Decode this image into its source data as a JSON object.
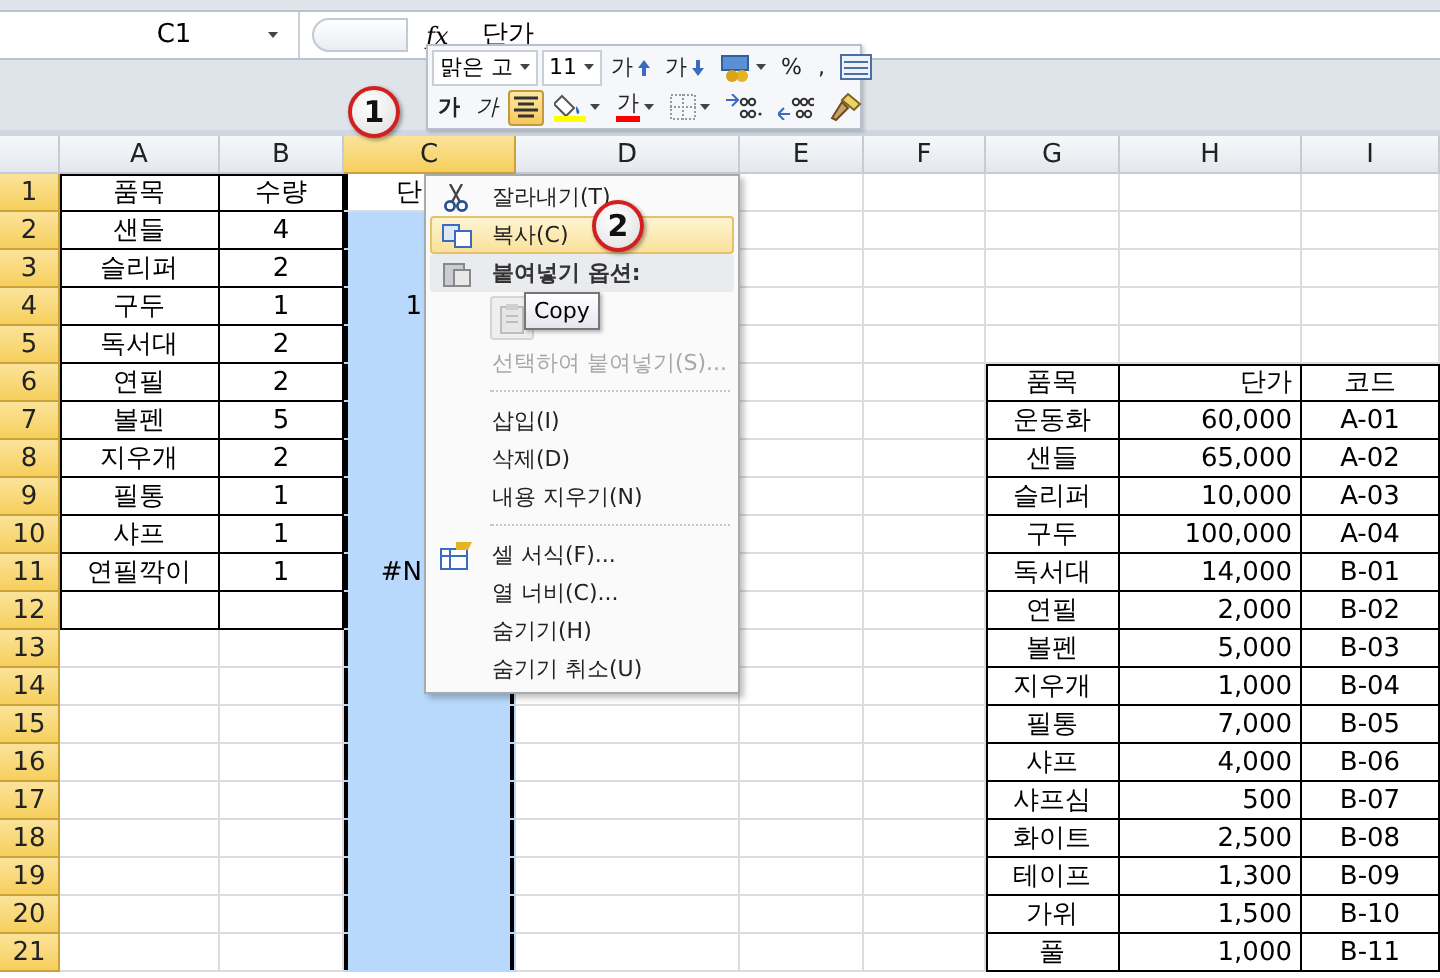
{
  "name_box": {
    "value": "C1"
  },
  "formula_bar": {
    "function_label": "fx",
    "value": "단가"
  },
  "mini_toolbar": {
    "font": "맑은 고",
    "size": "11",
    "row1": [
      {
        "kind": "grow",
        "label": "가"
      },
      {
        "kind": "shrink",
        "label": "가"
      },
      {
        "kind": "accounting"
      },
      {
        "kind": "percent",
        "label": "%"
      },
      {
        "kind": "comma",
        "label": ","
      },
      {
        "kind": "number-format"
      }
    ],
    "row2": [
      {
        "kind": "bold",
        "label": "가",
        "selected": false
      },
      {
        "kind": "italic",
        "label": "가",
        "selected": false
      },
      {
        "kind": "center",
        "selected": true
      },
      {
        "kind": "fill"
      },
      {
        "kind": "font-color",
        "label": "가"
      },
      {
        "kind": "borders"
      },
      {
        "kind": "increase-decimal"
      },
      {
        "kind": "decrease-decimal"
      },
      {
        "kind": "format-painter"
      }
    ]
  },
  "columns": [
    {
      "label": "A",
      "selected": false
    },
    {
      "label": "B",
      "selected": false
    },
    {
      "label": "C",
      "selected": true
    },
    {
      "label": "D",
      "selected": false
    },
    {
      "label": "E",
      "selected": false
    },
    {
      "label": "F",
      "selected": false
    },
    {
      "label": "G",
      "selected": false
    },
    {
      "label": "H",
      "selected": false
    },
    {
      "label": "I",
      "selected": false
    }
  ],
  "rows": [
    {
      "header": "1",
      "selected": true,
      "cells": {
        "a": "품목",
        "b": "수량",
        "c": "단"
      }
    },
    {
      "header": "2",
      "selected": true,
      "cells": {
        "a": "샌들",
        "b": "4"
      }
    },
    {
      "header": "3",
      "selected": true,
      "cells": {
        "a": "슬리퍼",
        "b": "2"
      }
    },
    {
      "header": "4",
      "selected": true,
      "cells": {
        "a": "구두",
        "b": "1",
        "c": "1"
      }
    },
    {
      "header": "5",
      "selected": true,
      "cells": {
        "a": "독서대",
        "b": "2"
      }
    },
    {
      "header": "6",
      "selected": true,
      "cells": {
        "a": "연필",
        "b": "2",
        "g": "품목",
        "h": "단가",
        "i": "코드"
      }
    },
    {
      "header": "7",
      "selected": true,
      "cells": {
        "a": "볼펜",
        "b": "5",
        "g": "운동화",
        "h": "60,000",
        "i": "A-01"
      }
    },
    {
      "header": "8",
      "selected": true,
      "cells": {
        "a": "지우개",
        "b": "2",
        "g": "샌들",
        "h": "65,000",
        "i": "A-02"
      }
    },
    {
      "header": "9",
      "selected": true,
      "cells": {
        "a": "필통",
        "b": "1",
        "g": "슬리퍼",
        "h": "10,000",
        "i": "A-03"
      }
    },
    {
      "header": "10",
      "selected": true,
      "cells": {
        "a": "샤프",
        "b": "1",
        "g": "구두",
        "h": "100,000",
        "i": "A-04"
      }
    },
    {
      "header": "11",
      "selected": true,
      "cells": {
        "a": "연필깍이",
        "b": "1",
        "c": "#N",
        "g": "독서대",
        "h": "14,000",
        "i": "B-01"
      }
    },
    {
      "header": "12",
      "selected": true,
      "cells": {
        "g": "연필",
        "h": "2,000",
        "i": "B-02"
      }
    },
    {
      "header": "13",
      "selected": true,
      "cells": {
        "g": "볼펜",
        "h": "5,000",
        "i": "B-03"
      }
    },
    {
      "header": "14",
      "selected": true,
      "cells": {
        "g": "지우개",
        "h": "1,000",
        "i": "B-04"
      }
    },
    {
      "header": "15",
      "selected": true,
      "cells": {
        "g": "필통",
        "h": "7,000",
        "i": "B-05"
      }
    },
    {
      "header": "16",
      "selected": true,
      "cells": {
        "g": "샤프",
        "h": "4,000",
        "i": "B-06"
      }
    },
    {
      "header": "17",
      "selected": true,
      "cells": {
        "g": "샤프심",
        "h": "500",
        "i": "B-07"
      }
    },
    {
      "header": "18",
      "selected": true,
      "cells": {
        "g": "화이트",
        "h": "2,500",
        "i": "B-08"
      }
    },
    {
      "header": "19",
      "selected": true,
      "cells": {
        "g": "테이프",
        "h": "1,300",
        "i": "B-09"
      }
    },
    {
      "header": "20",
      "selected": true,
      "cells": {
        "g": "가위",
        "h": "1,500",
        "i": "B-10"
      }
    },
    {
      "header": "21",
      "selected": true,
      "cells": {
        "g": "풀",
        "h": "1,000",
        "i": "B-11"
      }
    }
  ],
  "context_menu": [
    {
      "kind": "scissors",
      "label": "잘라내기(T)",
      "selected": false,
      "disabled": false
    },
    {
      "kind": "copy",
      "label": "복사(C)",
      "selected": true,
      "disabled": false
    },
    {
      "kind": "heading",
      "label": "붙여넣기 옵션:"
    },
    {
      "kind": "paste",
      "disabled": true
    },
    {
      "kind": "plain",
      "label": "선택하여 붙여넣기(S)...",
      "selected": false,
      "disabled": true
    },
    {
      "kind": "separator"
    },
    {
      "kind": "plain",
      "label": "삽입(I)",
      "selected": false,
      "disabled": false
    },
    {
      "kind": "plain",
      "label": "삭제(D)",
      "selected": false,
      "disabled": false
    },
    {
      "kind": "plain",
      "label": "내용 지우기(N)",
      "selected": false,
      "disabled": false
    },
    {
      "kind": "separator"
    },
    {
      "kind": "format",
      "label": "셀 서식(F)...",
      "selected": false,
      "disabled": false
    },
    {
      "kind": "plain",
      "label": "열 너비(C)...",
      "selected": false,
      "disabled": false
    },
    {
      "kind": "plain",
      "label": "숨기기(H)",
      "selected": false,
      "disabled": false
    },
    {
      "kind": "plain",
      "label": "숨기기 취소(U)",
      "selected": false,
      "disabled": false
    }
  ],
  "tooltip": "Copy",
  "step_badges": [
    "1",
    "2"
  ]
}
